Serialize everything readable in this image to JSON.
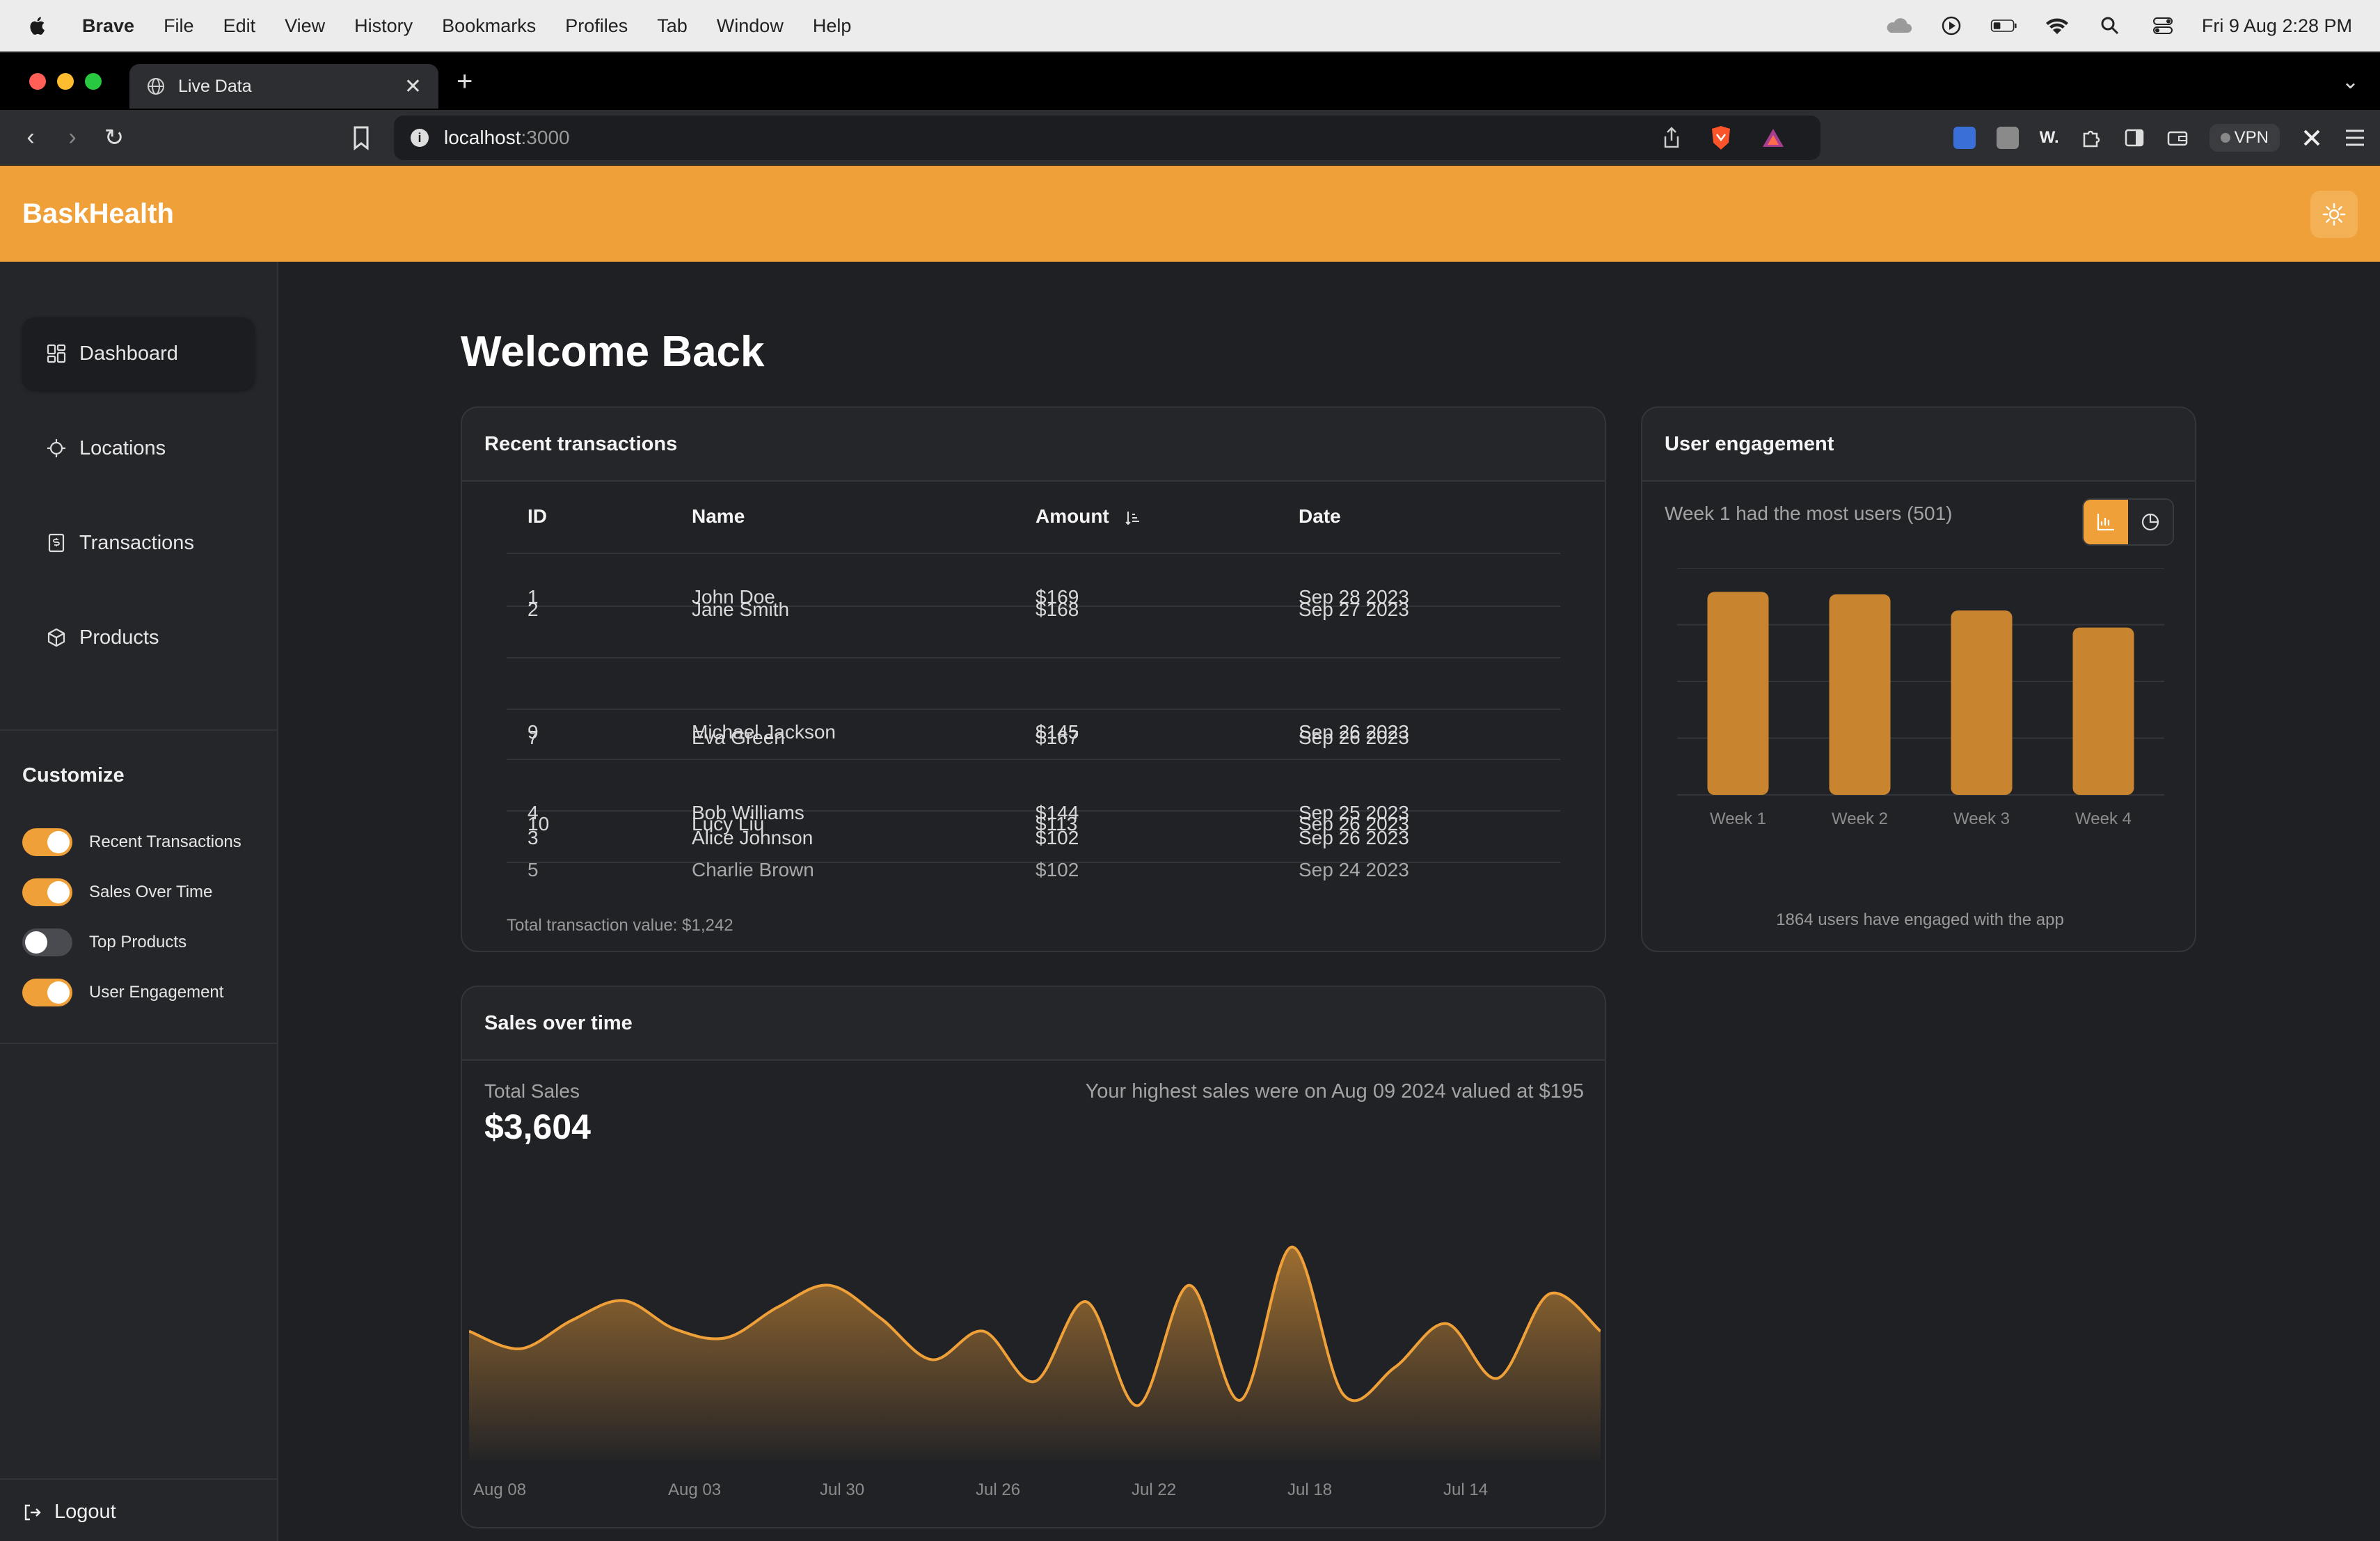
{
  "menubar": {
    "app": "Brave",
    "items": [
      "File",
      "Edit",
      "View",
      "History",
      "Bookmarks",
      "Profiles",
      "Tab",
      "Window",
      "Help"
    ],
    "clock": "Fri 9 Aug  2:28 PM"
  },
  "browser": {
    "tab_title": "Live Data",
    "url_host": "localhost",
    "url_port": ":3000",
    "vpn_label": "VPN"
  },
  "app": {
    "brand": "BaskHealth",
    "accent": "#f0a038"
  },
  "sidebar": {
    "nav": [
      {
        "label": "Dashboard",
        "icon": "dashboard-icon",
        "active": true
      },
      {
        "label": "Locations",
        "icon": "locations-icon",
        "active": false
      },
      {
        "label": "Transactions",
        "icon": "transactions-icon",
        "active": false
      },
      {
        "label": "Products",
        "icon": "products-icon",
        "active": false
      }
    ],
    "customize_title": "Customize",
    "toggles": [
      {
        "label": "Recent Transactions",
        "on": true
      },
      {
        "label": "Sales Over Time",
        "on": true
      },
      {
        "label": "Top Products",
        "on": false
      },
      {
        "label": "User Engagement",
        "on": true
      }
    ],
    "logout_label": "Logout"
  },
  "main": {
    "welcome": "Welcome Back"
  },
  "transactions": {
    "title": "Recent transactions",
    "columns": [
      "ID",
      "Name",
      "Amount",
      "Date"
    ],
    "rows": [
      {
        "id": "1",
        "name": "John Doe",
        "amount": "$169",
        "date": "Sep 28 2023"
      },
      {
        "id": "2",
        "name": "Jane Smith",
        "amount": "$168",
        "date": "Sep 27 2023"
      },
      {
        "id": "9",
        "name": "Michael Jackson",
        "amount": "$145",
        "date": "Sep 26 2023"
      },
      {
        "id": "7",
        "name": "Eva Green",
        "amount": "$167",
        "date": "Sep 26 2023"
      },
      {
        "id": "4",
        "name": "Bob Williams",
        "amount": "$144",
        "date": "Sep 25 2023"
      },
      {
        "id": "10",
        "name": "Lucy Liu",
        "amount": "$113",
        "date": "Sep 26 2023"
      },
      {
        "id": "3",
        "name": "Alice Johnson",
        "amount": "$102",
        "date": "Sep 26 2023"
      },
      {
        "id": "5",
        "name": "Charlie Brown",
        "amount": "$102",
        "date": "Sep 24 2023"
      }
    ],
    "total": "Total transaction value: $1,242"
  },
  "engagement": {
    "title": "User engagement",
    "note": "Week 1 had the most users (501)",
    "footer": "1864 users have engaged with the app"
  },
  "sales": {
    "title": "Sales over time",
    "total_label": "Total Sales",
    "total_value": "$3,604",
    "note": "Your highest sales were on Aug 09 2024 valued at $195"
  },
  "chart_data": [
    {
      "type": "bar",
      "categories": [
        "Week 1",
        "Week 2",
        "Week 3",
        "Week 4"
      ],
      "values": [
        501,
        495,
        455,
        413
      ],
      "ylim": [
        0,
        560
      ],
      "grid": true,
      "color": "#c9842f"
    },
    {
      "type": "area",
      "x": [
        "Aug 08",
        "Aug 03",
        "Jul 30",
        "Jul 26",
        "Jul 22",
        "Jul 18",
        "Jul 14"
      ],
      "values": [
        118,
        102,
        128,
        146,
        120,
        112,
        140,
        160,
        130,
        92,
        118,
        72,
        145,
        50,
        160,
        55,
        195,
        60,
        85,
        125,
        75,
        152,
        118
      ],
      "ylim": [
        0,
        210
      ],
      "color": "#f0a038"
    }
  ]
}
